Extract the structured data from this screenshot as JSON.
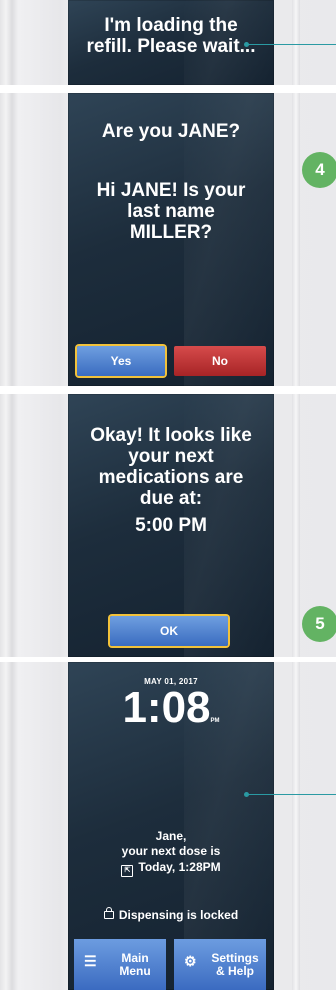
{
  "step_badges": [
    "4",
    "5"
  ],
  "screen_loading": {
    "message": "I'm loading the refill.  Please wait..."
  },
  "screen_identity": {
    "question": "Are you JANE?",
    "followup": "Hi JANE! Is your last name MILLER?",
    "yes_label": "Yes",
    "no_label": "No"
  },
  "screen_schedule": {
    "message": "Okay! It looks like your next medications are due at:",
    "time": "5:00 PM",
    "ok_label": "OK"
  },
  "screen_home": {
    "date": "MAY 01, 2017",
    "time": "1:08",
    "ampm": "PM",
    "dose_name": "Jane,",
    "dose_line": "your next dose is",
    "dose_time": "Today,  1:28PM",
    "lock_status": "Dispensing is locked",
    "main_menu_label": "Main Menu",
    "settings_label": "Settings & Help"
  },
  "icons": {
    "callout_dot": "callout-dot-icon",
    "calendar": "calendar-icon",
    "lock": "lock-icon",
    "menu": "menu-list-icon",
    "settings": "gear-icon"
  },
  "colors": {
    "screen_bg": "#1d2d3c",
    "button_blue": "#4a7fd0",
    "button_red": "#b83032",
    "selection_outline": "#f2c23a",
    "step_badge": "#63b363",
    "callout": "#2a9aa3"
  }
}
